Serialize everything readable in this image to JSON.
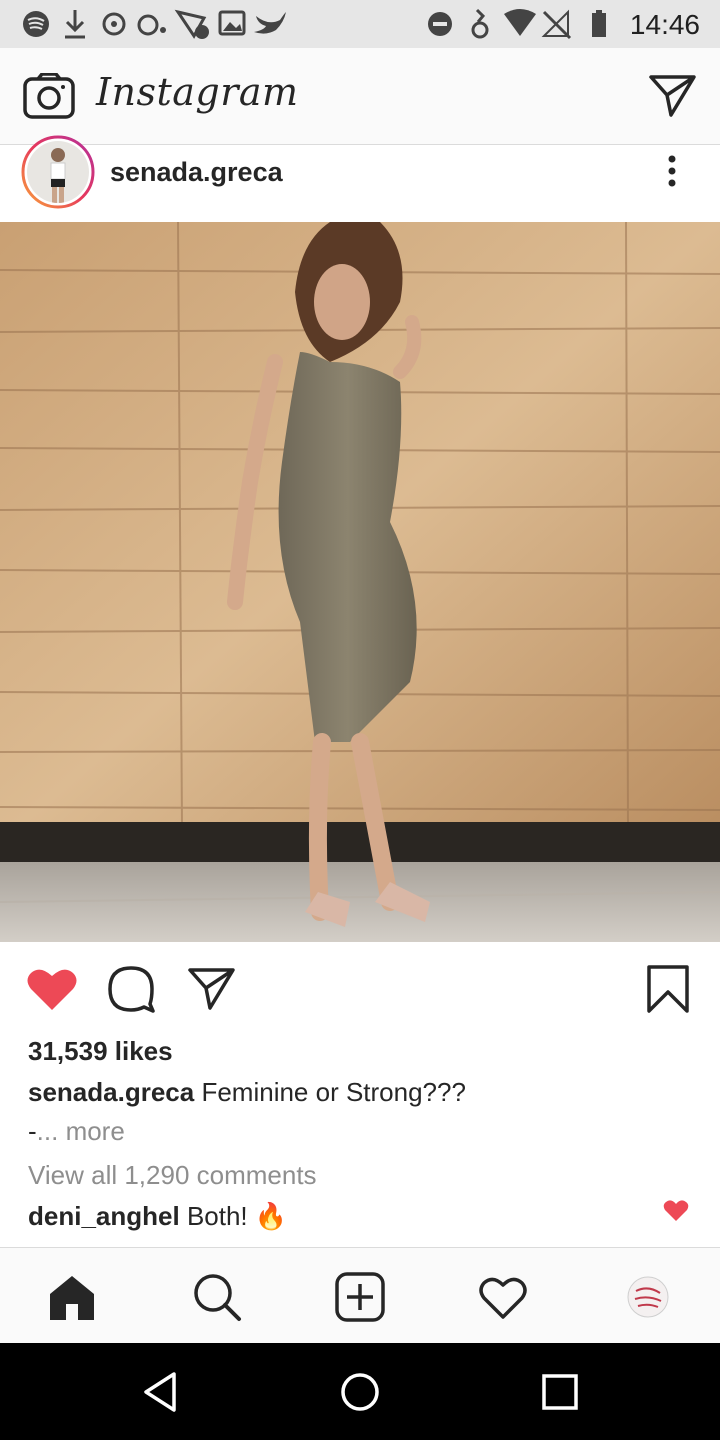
{
  "status_bar": {
    "time": "14:46",
    "left_icons": [
      "spotify-icon",
      "download-icon",
      "sync-icon",
      "voicemail-icon",
      "network-icon",
      "gallery-icon",
      "twitter-icon"
    ],
    "right_icons": [
      "dnd-icon",
      "vibrate-icon",
      "wifi-icon",
      "no-sim-icon",
      "battery-icon"
    ]
  },
  "header": {
    "brand": "Instagram",
    "left_icon": "camera-icon",
    "right_icon": "direct-message-icon"
  },
  "post": {
    "username": "senada.greca",
    "menu_icon": "more-options-icon",
    "liked": true,
    "like_color": "#ed4956",
    "likes_text": "31,539 likes",
    "caption": {
      "username": "senada.greca",
      "text": "Feminine or Strong???",
      "continuation": "-",
      "more_label": "... more"
    },
    "view_comments": "View all 1,290 comments",
    "comments": [
      {
        "username": "deni_anghel",
        "text": "Both!",
        "emoji": "🔥",
        "liked": true
      }
    ]
  },
  "bottom_nav": {
    "items": [
      "home-icon",
      "search-icon",
      "new-post-icon",
      "activity-icon",
      "profile-icon"
    ]
  },
  "system_nav": {
    "items": [
      "back-icon",
      "home-circle-icon",
      "recents-icon"
    ]
  }
}
